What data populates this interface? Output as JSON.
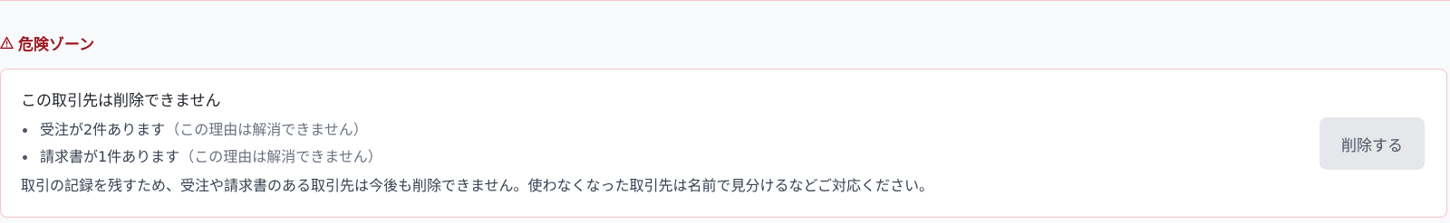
{
  "danger_zone": {
    "heading": "危険ゾーン",
    "icon": "warning-triangle-icon",
    "title": "この取引先は削除できません",
    "reasons": [
      {
        "text": "受注が2件あります",
        "note": "（この理由は解消できません）"
      },
      {
        "text": "請求書が1件あります",
        "note": "（この理由は解消できません）"
      }
    ],
    "explanation": "取引の記録を残すため、受注や請求書のある取引先は今後も削除できません。使わなくなった取引先は名前で見分けるなどご対応ください。",
    "delete_button_label": "削除する",
    "colors": {
      "danger_text": "#9a1620",
      "card_border": "#f3c3c8",
      "button_bg": "#e5e7eb"
    }
  }
}
